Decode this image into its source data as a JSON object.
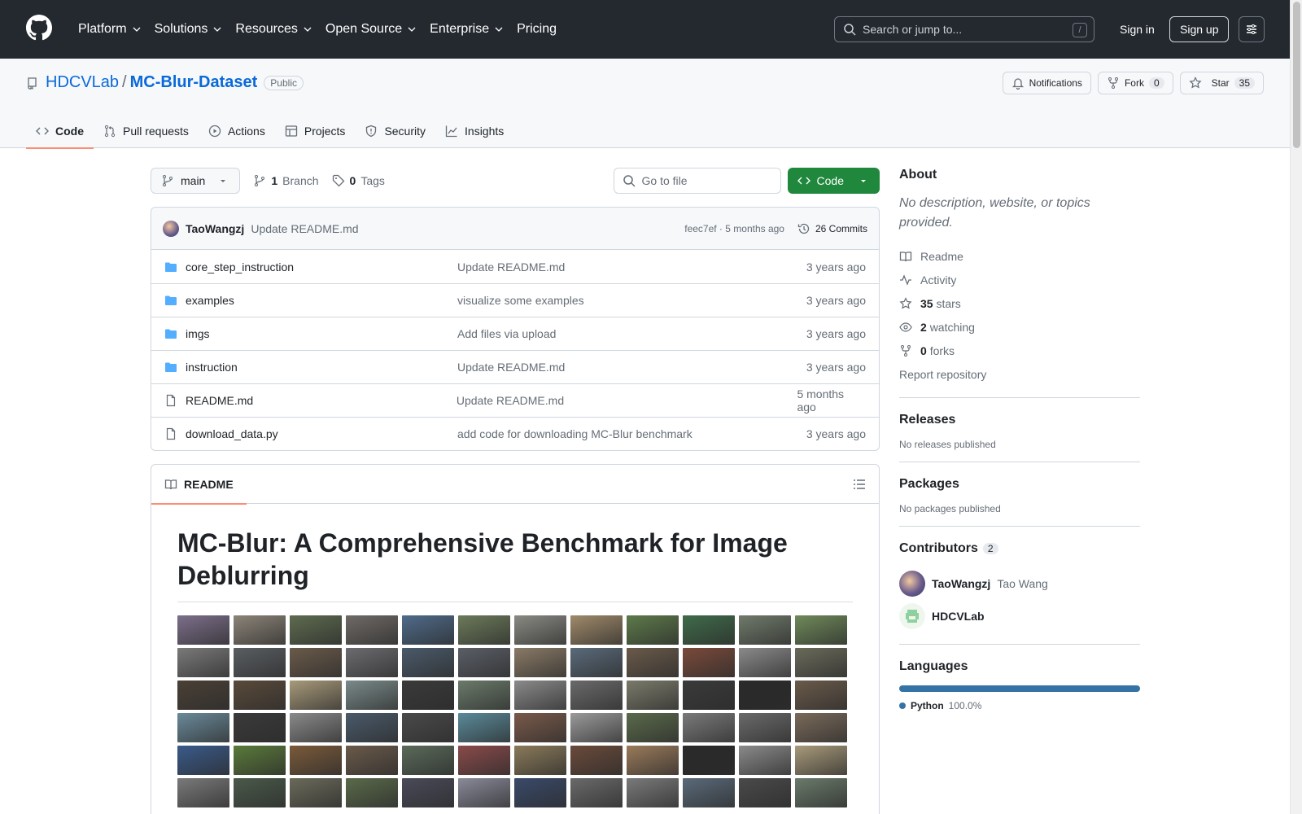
{
  "header": {
    "nav": [
      "Platform",
      "Solutions",
      "Resources",
      "Open Source",
      "Enterprise",
      "Pricing"
    ],
    "search_placeholder": "Search or jump to...",
    "search_shortcut": "/",
    "signin": "Sign in",
    "signup": "Sign up"
  },
  "repo": {
    "owner": "HDCVLab",
    "name": "MC-Blur-Dataset",
    "visibility": "Public",
    "notifications_label": "Notifications",
    "fork_label": "Fork",
    "fork_count": "0",
    "star_label": "Star",
    "star_count": "35",
    "tabs": [
      "Code",
      "Pull requests",
      "Actions",
      "Projects",
      "Security",
      "Insights"
    ]
  },
  "toolbar": {
    "branch": "main",
    "branch_count": "1",
    "branch_label": "Branch",
    "tag_count": "0",
    "tag_label": "Tags",
    "goto_placeholder": "Go to file",
    "code_label": "Code"
  },
  "commit": {
    "author": "TaoWangzj",
    "message": "Update README.md",
    "meta": "feec7ef · 5 months ago",
    "commits": "26 Commits"
  },
  "files": [
    {
      "name": "core_step_instruction",
      "type": "dir",
      "message": "Update README.md",
      "time": "3 years ago"
    },
    {
      "name": "examples",
      "type": "dir",
      "message": "visualize some examples",
      "time": "3 years ago"
    },
    {
      "name": "imgs",
      "type": "dir",
      "message": "Add files via upload",
      "time": "3 years ago"
    },
    {
      "name": "instruction",
      "type": "dir",
      "message": "Update README.md",
      "time": "3 years ago"
    },
    {
      "name": "README.md",
      "type": "file",
      "message": "Update README.md",
      "time": "5 months ago"
    },
    {
      "name": "download_data.py",
      "type": "file",
      "message": "add code for downloading MC-Blur benchmark",
      "time": "3 years ago"
    }
  ],
  "readme": {
    "tab": "README",
    "title": "MC-Blur: A Comprehensive Benchmark for Image Deblurring"
  },
  "sidebar": {
    "about_title": "About",
    "about_desc": "No description, website, or topics provided.",
    "readme": "Readme",
    "activity": "Activity",
    "stars_count": "35",
    "stars_label": "stars",
    "watching_count": "2",
    "watching_label": "watching",
    "forks_count": "0",
    "forks_label": "forks",
    "report": "Report repository",
    "releases_title": "Releases",
    "releases_note": "No releases published",
    "packages_title": "Packages",
    "packages_note": "No packages published",
    "contributors_title": "Contributors",
    "contributors_count": "2",
    "contributors": [
      {
        "login": "TaoWangzj",
        "name": "Tao Wang"
      },
      {
        "login": "HDCVLab",
        "name": ""
      }
    ],
    "languages_title": "Languages",
    "language": "Python",
    "language_pct": "100.0%"
  },
  "colors": {
    "header_bg": "#24292f",
    "accent_tab": "#fd8c73",
    "link": "#0969da",
    "code_button": "#1f883d",
    "python": "#3572a5"
  }
}
